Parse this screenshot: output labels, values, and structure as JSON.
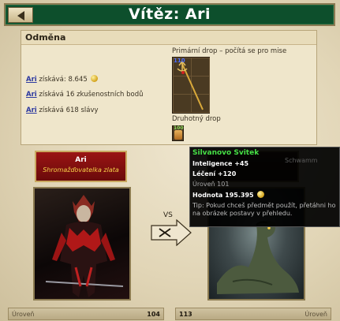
{
  "header": {
    "title": "Vítěz: Ari"
  },
  "reward": {
    "heading": "Odměna",
    "player_name": "Ari",
    "gains": [
      {
        "verb": "získává:",
        "text": "8.645"
      },
      {
        "verb": "získává",
        "text": "16 zkušenostních bodů"
      },
      {
        "verb": "získává",
        "text": "618 slávy"
      }
    ],
    "primary_drop_label": "Primární drop – počítá se pro mise",
    "primary_drop_amount": "110",
    "secondary_drop_label": "Druhotný drop",
    "secondary_drop_amount": "100"
  },
  "fighter_left": {
    "name": "Ari",
    "title": "Shromažďovatelka zlata",
    "level_label": "Úroveň",
    "level": "104"
  },
  "fighter_right": {
    "level_label": "Úroveň",
    "level": "113"
  },
  "vs_text": "VS",
  "tooltip": {
    "name": "Silvanovo Svitek",
    "stats": [
      "Inteligence +45",
      "Léčení +120"
    ],
    "level_text": "Úroveň 101",
    "value_label": "Hodnota",
    "value": "195.395",
    "hint": "Tip: Pokud chceš předmět použít, přetáhni ho na obrázek postavy v přehledu.",
    "behind_text": "Schwamm"
  },
  "colors": {
    "header_bg": "#0d4f2c",
    "banner_red": "#9a1414",
    "tooltip_green": "#46e046",
    "link_blue": "#2d3aa0"
  }
}
